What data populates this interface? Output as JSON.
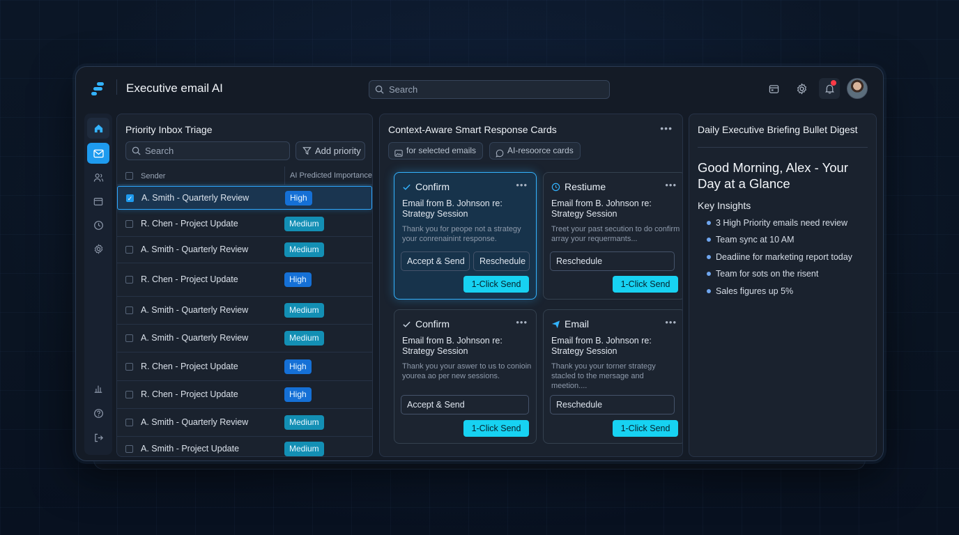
{
  "app": {
    "title": "Executive email AI"
  },
  "top": {
    "search_placeholder": "Search"
  },
  "inbox": {
    "title": "Priority Inbox Triage",
    "search_placeholder": "Search",
    "add_priority_label": "Add priority",
    "col_sender": "Sender",
    "col_importance": "AI Predicted Importance",
    "rows": [
      {
        "sender": "A. Smith - Quarterly Review",
        "importance": "High",
        "checked": true
      },
      {
        "sender": "R. Chen - Project Update",
        "importance": "Medium",
        "checked": false
      },
      {
        "sender": "A. Smith - Quarterly Review",
        "importance": "Medium",
        "checked": false
      },
      {
        "sender": "R. Chen - Project Update",
        "importance": "High",
        "checked": false
      },
      {
        "sender": "A. Smith - Quarterly Review",
        "importance": "Medium",
        "checked": false
      },
      {
        "sender": "A. Smith - Quarterly Review",
        "importance": "Medium",
        "checked": false
      },
      {
        "sender": "R. Chen - Project Update",
        "importance": "High",
        "checked": false
      },
      {
        "sender": "R. Chen - Project Update",
        "importance": "High",
        "checked": false
      },
      {
        "sender": "A. Smith - Quarterly Review",
        "importance": "Medium",
        "checked": false
      },
      {
        "sender": "A. Smith - Project Update",
        "importance": "Medium",
        "checked": false
      }
    ]
  },
  "smart": {
    "title": "Context-Aware Smart Response Cards",
    "chip_selected": "for selected emails",
    "chip_ai": "AI-resoorce cards",
    "cards": [
      {
        "action": "Confirm",
        "icon": "check-icon",
        "subject": "Email from B. Johnson re: Strategy Session",
        "body": "Thank you for peope not a strategy your conrenainint response.",
        "btn1": "Accept & Send",
        "btn2": "Reschedule",
        "send": "1-Click Send"
      },
      {
        "action": "Restiume",
        "icon": "clock-icon",
        "subject": "Email from B. Johnson re: Strategy Session",
        "body": "Treet your past secution to do confirm array your requermants...",
        "btn1": "Reschedule",
        "send": "1-Click Send"
      },
      {
        "action": "Confirm",
        "icon": "check-icon",
        "subject": "Email from B. Johnson re: Strategy Session",
        "body": "Thank you your aswer to us to conioin yourea ao per new sessions.",
        "btn1": "Accept & Send",
        "send": "1-Click Send"
      },
      {
        "action": "Email",
        "icon": "send-icon",
        "subject": "Email from B. Johnson re: Strategy Session",
        "body": "Thank you your torner strategy stacled to the mersage and meetion....",
        "btn1": "Reschedule",
        "send": "1-Click Send"
      }
    ]
  },
  "brief": {
    "title": "Daily Executive Briefing Bullet Digest",
    "greeting": "Good Morning, Alex - Your Day at a Glance",
    "insights_title": "Key Insights",
    "insights": [
      "3 High Priority emails need review",
      "Team sync at 10 AM",
      "Deadiine for marketing report today",
      "Team for sots on the risent",
      "Sales figures up 5%"
    ]
  },
  "colors": {
    "accent": "#1e9bef",
    "send_button": "#17d2f2",
    "badge_high": "#1570d6",
    "badge_medium": "#138fb4",
    "notification_dot": "#ff3b47"
  }
}
